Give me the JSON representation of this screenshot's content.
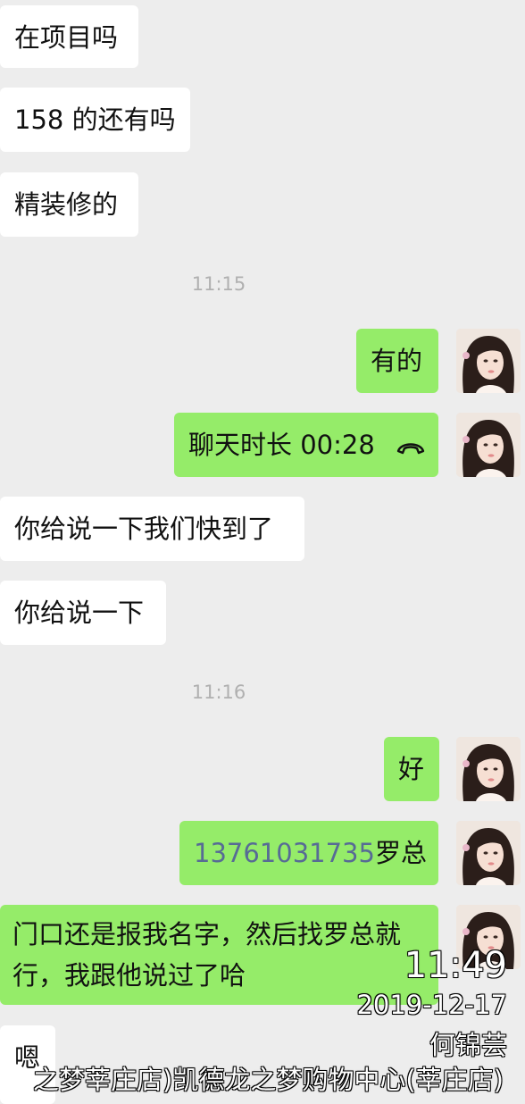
{
  "messages": {
    "m1": "在项目吗",
    "m2": "158 的还有吗",
    "m3": "精装修的",
    "t1": "11:15",
    "m4": "有的",
    "m5_label": "聊天时长",
    "m5_duration": "00:28",
    "m6": "你给说一下我们快到了",
    "m7": "你给说一下",
    "t2": "11:16",
    "m8": "好",
    "m9_phone": "13761031735",
    "m9_suffix": "罗总",
    "m10_line1": "门口还是报我名字，然后找罗总就",
    "m10_line2": "行，我跟他说过了哈",
    "m11": "嗯"
  },
  "watermark": {
    "time": "11:49",
    "date": "2019-12-17",
    "name": "何锦芸",
    "location": "之梦莘庄店)凯德龙之梦购物中心(莘庄店)"
  },
  "colors": {
    "background": "#ededed",
    "incoming": "#ffffff",
    "outgoing": "#95ec69",
    "phone_link": "#576b95",
    "timestamp": "#b0b0b0"
  },
  "icons": {
    "avatar": "avatar-photo",
    "call": "phone-hangup-icon"
  }
}
